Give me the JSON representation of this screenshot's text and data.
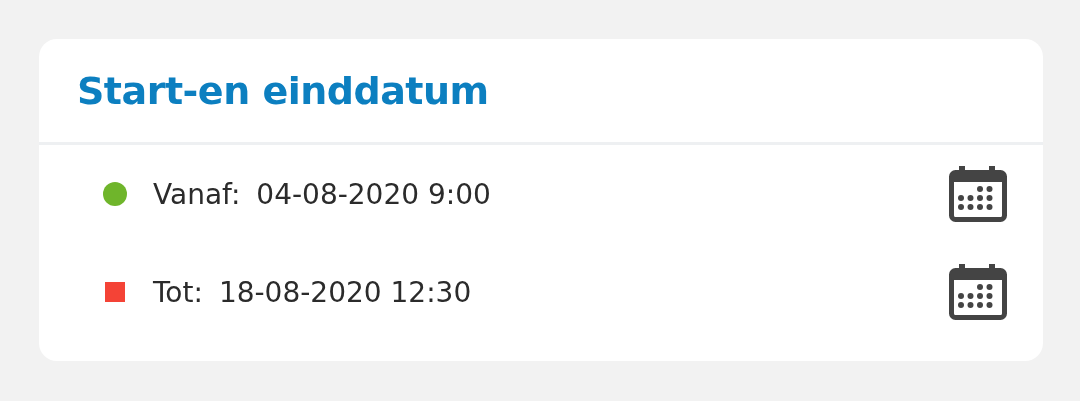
{
  "card": {
    "title": "Start-en einddatum",
    "rows": [
      {
        "kind": "circle",
        "color": "#6fb52b",
        "label": "Vanaf:",
        "value": "04-08-2020 9:00"
      },
      {
        "kind": "square",
        "color": "#f44336",
        "label": "Tot:",
        "value": "18-08-2020 12:30"
      }
    ]
  }
}
